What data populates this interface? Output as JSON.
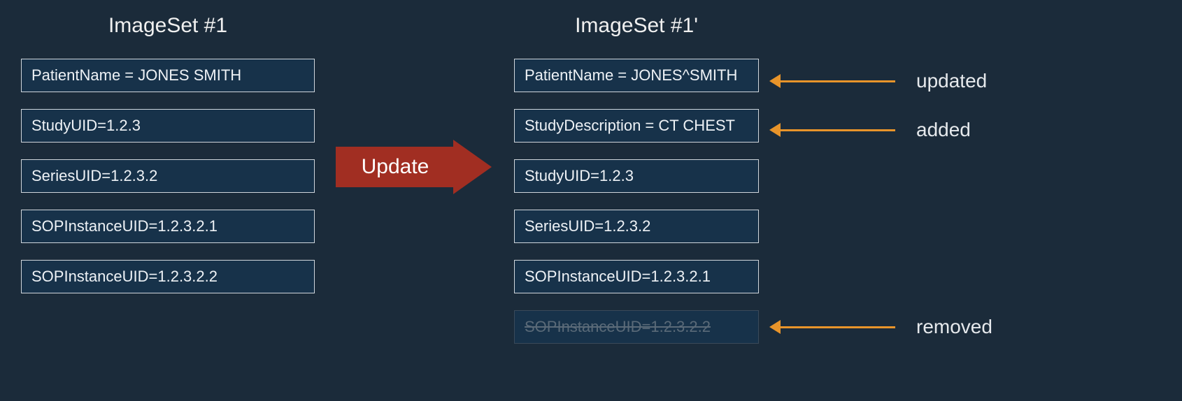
{
  "left": {
    "title": "ImageSet #1",
    "rows": [
      "PatientName = JONES SMITH",
      "StudyUID=1.2.3",
      "SeriesUID=1.2.3.2",
      "SOPInstanceUID=1.2.3.2.1",
      "SOPInstanceUID=1.2.3.2.2"
    ]
  },
  "arrow": {
    "label": "Update"
  },
  "right": {
    "title": "ImageSet #1'",
    "rows": [
      "PatientName = JONES^SMITH",
      "StudyDescription = CT CHEST",
      "StudyUID=1.2.3",
      "SeriesUID=1.2.3.2",
      "SOPInstanceUID=1.2.3.2.1",
      "SOPInstanceUID=1.2.3.2.2"
    ]
  },
  "annotations": {
    "updated": "updated",
    "added": "added",
    "removed": "removed"
  },
  "colors": {
    "background": "#1b2b3a",
    "box_fill": "#17324a",
    "box_border": "#d0d6dc",
    "arrow_red": "#a12e22",
    "arrow_orange": "#e8942a"
  }
}
